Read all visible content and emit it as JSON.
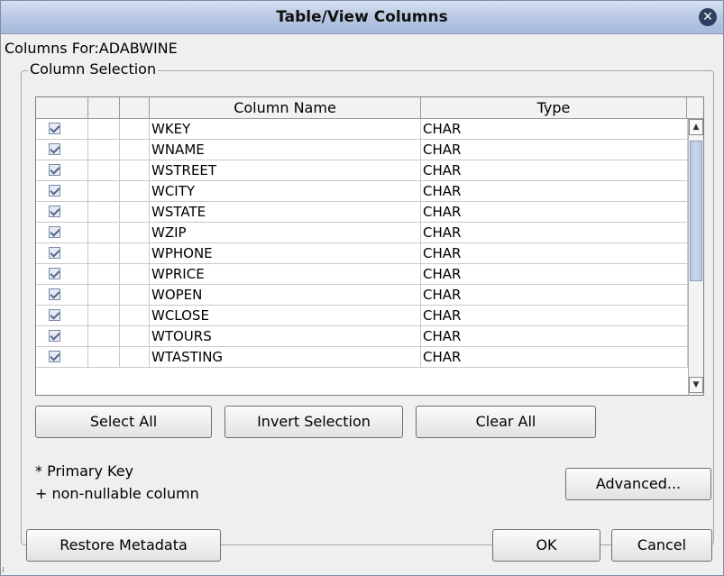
{
  "window": {
    "title": "Table/View Columns",
    "close_icon": "close-icon"
  },
  "columns_for": "Columns For:ADABWINE",
  "column_selection": {
    "legend": "Column Selection",
    "headers": [
      "",
      "",
      "",
      "Column Name",
      "Type"
    ],
    "rows": [
      {
        "checked": true,
        "name": "WKEY",
        "type": "CHAR"
      },
      {
        "checked": true,
        "name": "WNAME",
        "type": "CHAR"
      },
      {
        "checked": true,
        "name": "WSTREET",
        "type": "CHAR"
      },
      {
        "checked": true,
        "name": "WCITY",
        "type": "CHAR"
      },
      {
        "checked": true,
        "name": "WSTATE",
        "type": "CHAR"
      },
      {
        "checked": true,
        "name": "WZIP",
        "type": "CHAR"
      },
      {
        "checked": true,
        "name": "WPHONE",
        "type": "CHAR"
      },
      {
        "checked": true,
        "name": "WPRICE",
        "type": "CHAR"
      },
      {
        "checked": true,
        "name": "WOPEN",
        "type": "CHAR"
      },
      {
        "checked": true,
        "name": "WCLOSE",
        "type": "CHAR"
      },
      {
        "checked": true,
        "name": "WTOURS",
        "type": "CHAR"
      },
      {
        "checked": true,
        "name": "WTASTING",
        "type": "CHAR"
      }
    ]
  },
  "buttons": {
    "select_all": "Select All",
    "invert_selection": "Invert Selection",
    "clear_all": "Clear All",
    "advanced": "Advanced...",
    "restore_metadata": "Restore Metadata",
    "ok": "OK",
    "cancel": "Cancel"
  },
  "legend_notes": {
    "primary_key": "* Primary Key",
    "non_nullable": "+ non-nullable column"
  },
  "colors": {
    "title_bar": "#b9c8e3",
    "dialog_bg": "#efefef",
    "scroll_thumb": "#b6c7e3"
  }
}
